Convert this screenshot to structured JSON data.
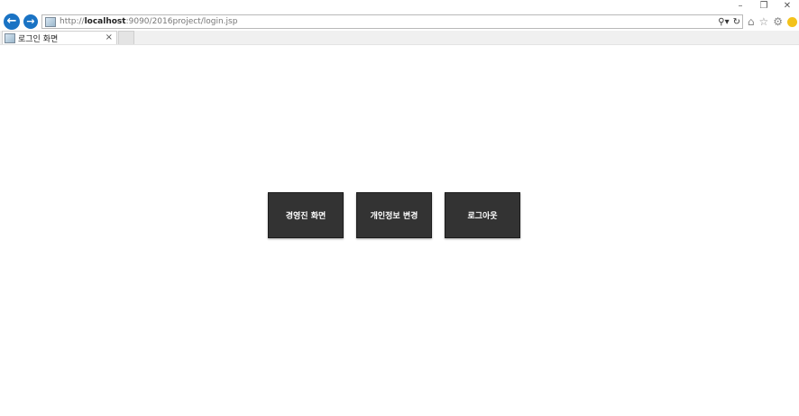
{
  "window": {
    "minimize": "–",
    "restore": "❐",
    "close": "✕"
  },
  "address": {
    "scheme": "http://",
    "host": "localhost",
    "rest": ":9090/2016project/login.jsp"
  },
  "tab": {
    "title": "로그인 화면",
    "close": "×"
  },
  "buttons": {
    "admin": "경영진 화면",
    "profile": "개인정보 변경",
    "logout": "로그아웃"
  },
  "icons": {
    "back": "back-arrow-icon",
    "forward": "forward-arrow-icon",
    "search": "search-icon",
    "refresh": "refresh-icon",
    "home": "home-icon",
    "favorites": "star-icon",
    "settings": "gear-icon",
    "feedback": "smiley-icon"
  },
  "colors": {
    "nav_blue": "#1a73c4",
    "button_bg": "#333333",
    "button_text": "#ffffff"
  }
}
